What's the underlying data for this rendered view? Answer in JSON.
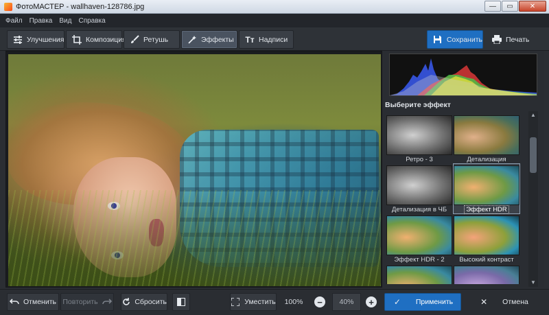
{
  "window": {
    "title": "ФотоМАСТЕР - wallhaven-128786.jpg",
    "minimize_glyph": "—",
    "maximize_glyph": "▭",
    "close_glyph": "✕"
  },
  "menu": [
    "Файл",
    "Правка",
    "Вид",
    "Справка"
  ],
  "toolbar": {
    "tabs": [
      {
        "label": "Улучшения",
        "icon": "sliders-icon"
      },
      {
        "label": "Композиция",
        "icon": "crop-icon"
      },
      {
        "label": "Ретушь",
        "icon": "brush-icon"
      },
      {
        "label": "Эффекты",
        "icon": "magic-wand-icon",
        "active": true
      },
      {
        "label": "Надписи",
        "icon": "text-icon"
      }
    ],
    "save_label": "Сохранить",
    "print_label": "Печать"
  },
  "panel": {
    "title": "Выберите эффект",
    "effects": [
      {
        "label": "Ретро - 3",
        "style": "gray"
      },
      {
        "label": "Детализация",
        "style": "color"
      },
      {
        "label": "Детализация в ЧБ",
        "style": "gray"
      },
      {
        "label": "Эффект HDR",
        "style": "hdr",
        "selected": true
      },
      {
        "label": "Эффект HDR - 2",
        "style": "hdr"
      },
      {
        "label": "Высокий контраст",
        "style": "contrast"
      },
      {
        "label": "",
        "style": "hdr"
      },
      {
        "label": "",
        "style": "purple"
      }
    ]
  },
  "bottombar": {
    "undo_label": "Отменить",
    "redo_label": "Повторить",
    "reset_label": "Сбросить",
    "fit_label": "Уместить",
    "zoom_100": "100%",
    "zoom_value": "40%",
    "apply_label": "Применить",
    "cancel_label": "Отмена"
  },
  "colors": {
    "accent": "#1f6fc2",
    "background": "#2b2e33"
  }
}
